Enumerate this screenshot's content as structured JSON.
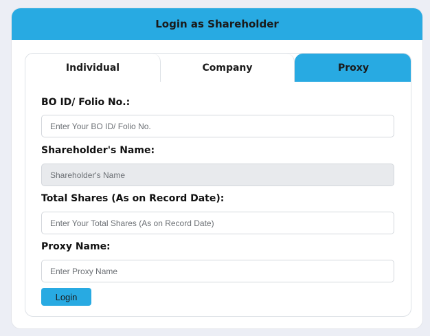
{
  "header": {
    "title": "Login as Shareholder"
  },
  "tabs": [
    {
      "label": "Individual",
      "active": false
    },
    {
      "label": "Company",
      "active": false
    },
    {
      "label": "Proxy",
      "active": true
    }
  ],
  "form": {
    "bo_id": {
      "label": "BO ID/ Folio No.:",
      "placeholder": "Enter Your BO ID/ Folio No."
    },
    "name": {
      "label": "Shareholder's Name:",
      "placeholder": "Shareholder's Name"
    },
    "shares": {
      "label": "Total Shares (As on Record Date):",
      "placeholder": "Enter Your Total Shares (As on Record Date)"
    },
    "proxy": {
      "label": "Proxy Name:",
      "placeholder": "Enter Proxy Name"
    },
    "submit_label": "Login"
  },
  "colors": {
    "accent": "#28aae2",
    "page_bg": "#eceef5",
    "disabled_field": "#e8eaed"
  }
}
